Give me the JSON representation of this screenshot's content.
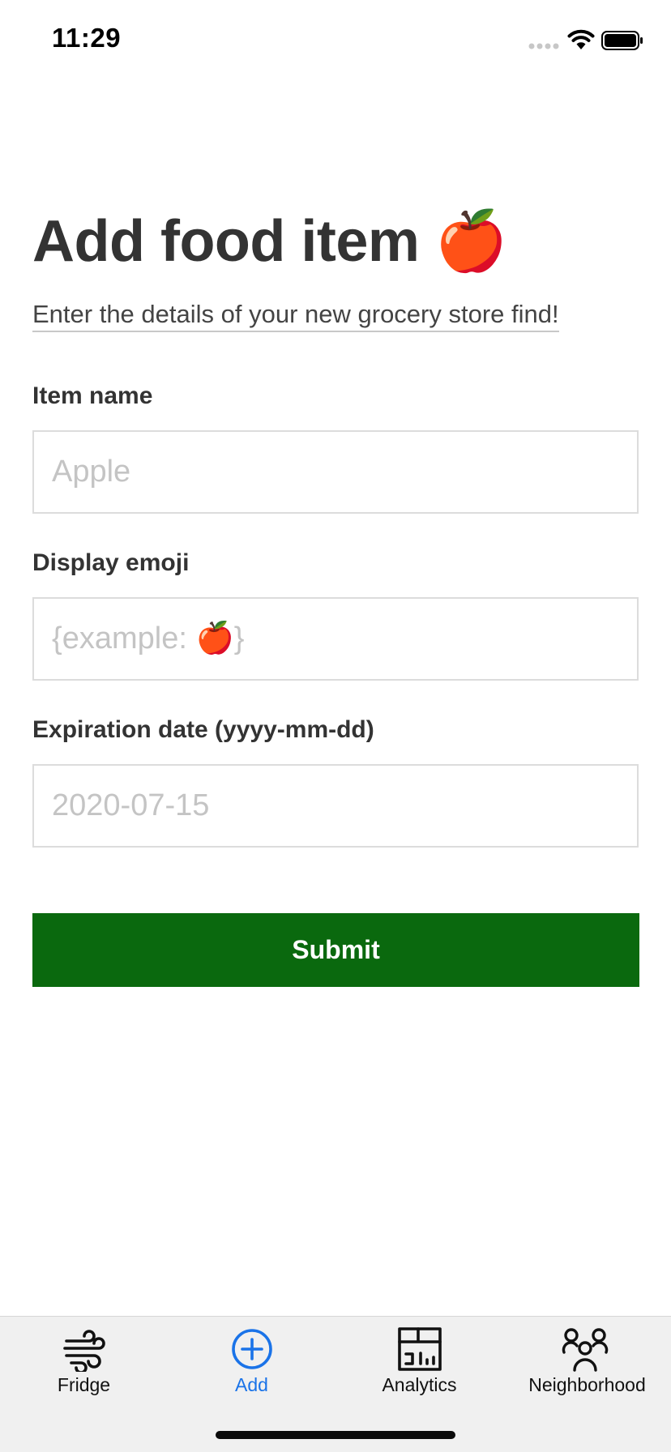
{
  "status_bar": {
    "time": "11:29"
  },
  "main": {
    "title": "Add food item 🍎",
    "subtitle": "Enter the details of your new grocery store find!",
    "fields": [
      {
        "label": "Item name",
        "value": "",
        "placeholder": "Apple"
      },
      {
        "label": "Display emoji",
        "value": "",
        "placeholder": "{example: 🍎}"
      },
      {
        "label": "Expiration date (yyyy-mm-dd)",
        "value": "",
        "placeholder": "2020-07-15"
      }
    ],
    "submit_label": "Submit"
  },
  "tab_bar": {
    "items": [
      {
        "label": "Fridge",
        "icon": "wind-icon",
        "active": false
      },
      {
        "label": "Add",
        "icon": "plus-circle-icon",
        "active": true
      },
      {
        "label": "Analytics",
        "icon": "analytics-icon",
        "active": false
      },
      {
        "label": "Neighborhood",
        "icon": "people-icon",
        "active": false
      }
    ]
  },
  "colors": {
    "submit_background": "#0a690e",
    "active_tab": "#1a73e8",
    "tab_bar_background": "#f0f0f0",
    "text": "#333333",
    "placeholder": "#c4c4c4"
  }
}
